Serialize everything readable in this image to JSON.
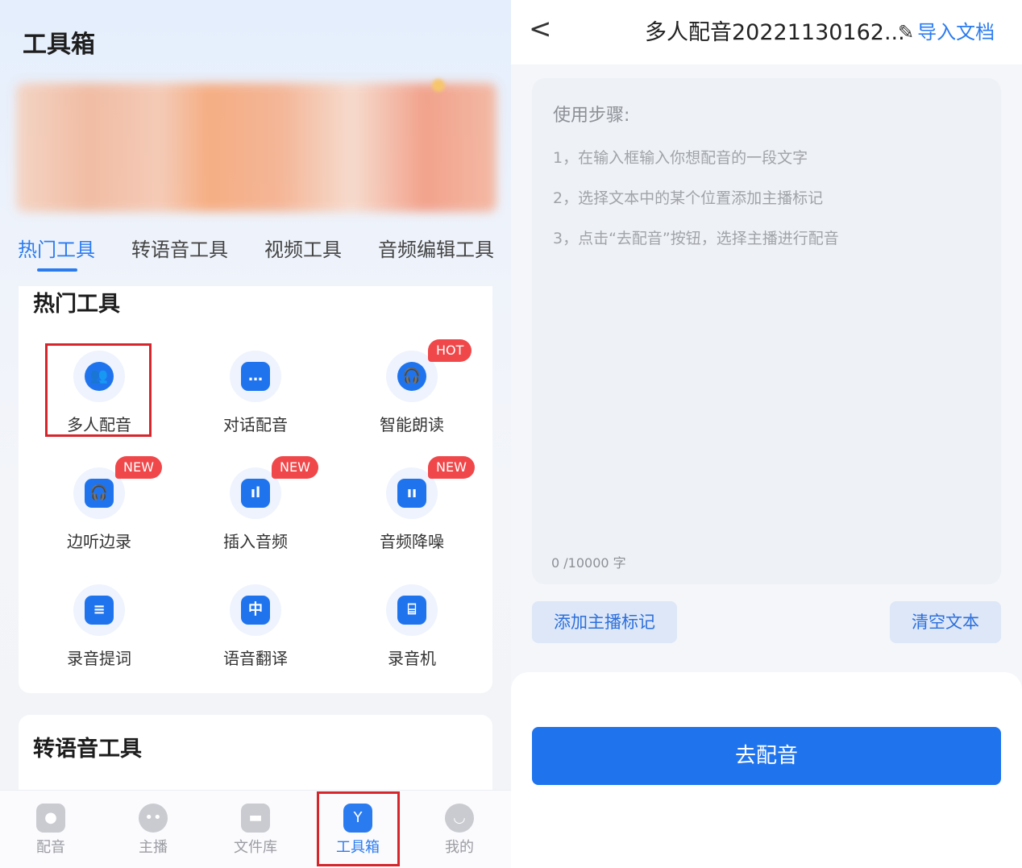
{
  "left": {
    "title": "工具箱",
    "tabs": [
      {
        "label": "热门工具",
        "active": true
      },
      {
        "label": "转语音工具",
        "active": false
      },
      {
        "label": "视频工具",
        "active": false
      },
      {
        "label": "音频编辑工具",
        "active": false
      }
    ],
    "hot_section_title": "热门工具",
    "tools": [
      {
        "label": "多人配音",
        "icon": "people-icon",
        "glyph": "👥",
        "badge": ""
      },
      {
        "label": "对话配音",
        "icon": "chat-icon",
        "glyph": "…",
        "badge": ""
      },
      {
        "label": "智能朗读",
        "icon": "headphones-icon",
        "glyph": "🎧",
        "badge": "HOT"
      },
      {
        "label": "边听边录",
        "icon": "listen-record-icon",
        "glyph": "🎧",
        "badge": "NEW"
      },
      {
        "label": "插入音频",
        "icon": "insert-audio-icon",
        "glyph": "ıl",
        "badge": "NEW"
      },
      {
        "label": "音频降噪",
        "icon": "denoise-icon",
        "glyph": "ıı",
        "badge": "NEW"
      },
      {
        "label": "录音提词",
        "icon": "prompter-icon",
        "glyph": "≡",
        "badge": ""
      },
      {
        "label": "语音翻译",
        "icon": "translate-icon",
        "glyph": "中",
        "badge": ""
      },
      {
        "label": "录音机",
        "icon": "recorder-icon",
        "glyph": "⌸",
        "badge": ""
      }
    ],
    "tts_section_title": "转语音工具",
    "nav": [
      {
        "label": "配音",
        "icon": "mic-icon",
        "glyph": "●",
        "active": false
      },
      {
        "label": "主播",
        "icon": "face-icon",
        "glyph": "••",
        "active": false
      },
      {
        "label": "文件库",
        "icon": "file-icon",
        "glyph": "▬",
        "active": false
      },
      {
        "label": "工具箱",
        "icon": "toolbox-icon",
        "glyph": "Y",
        "active": true
      },
      {
        "label": "我的",
        "icon": "profile-icon",
        "glyph": "◡",
        "active": false
      }
    ]
  },
  "right": {
    "doc_title": "多人配音20221130162...",
    "import_label": "导入文档",
    "steps_title": "使用步骤:",
    "steps": [
      "1，在输入框输入你想配音的一段文字",
      "2，选择文本中的某个位置添加主播标记",
      "3，点击“去配音”按钮，选择主播进行配音"
    ],
    "counter": "0 /10000 字",
    "add_marker_label": "添加主播标记",
    "clear_label": "清空文本",
    "go_label": "去配音"
  },
  "colors": {
    "accent": "#2b7bf0",
    "badge": "#f0484a",
    "highlight": "#d6262c"
  }
}
